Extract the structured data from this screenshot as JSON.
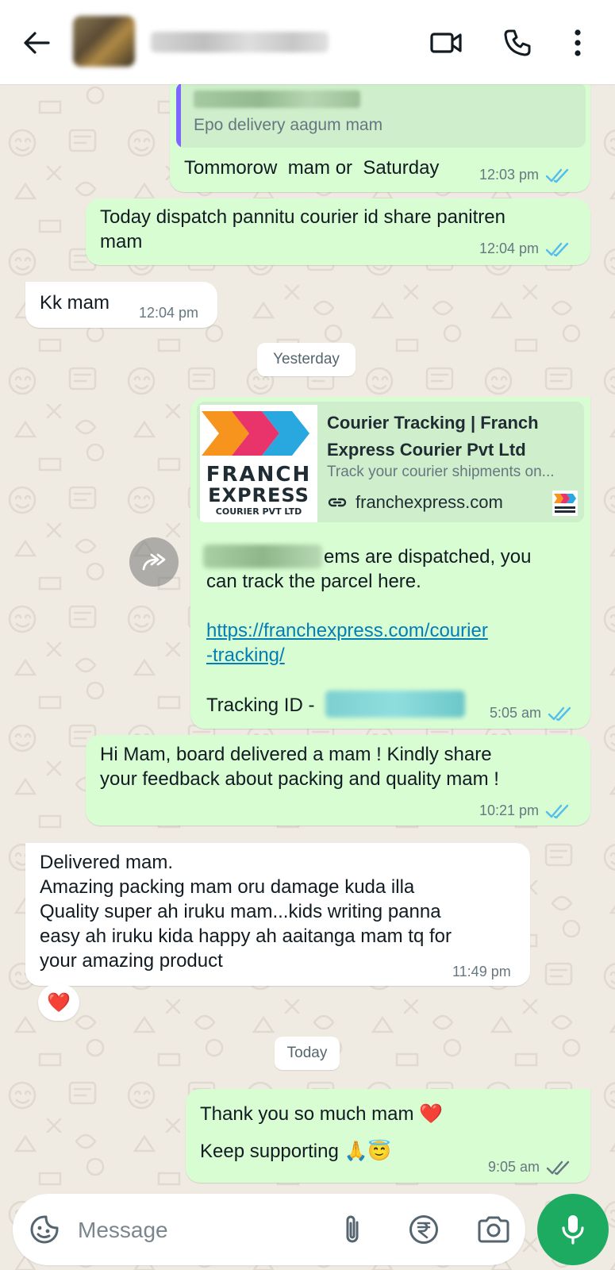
{
  "header": {
    "back_icon": "arrow-left-icon",
    "video_icon": "video-camera-icon",
    "call_icon": "phone-icon",
    "menu_icon": "more-vertical-icon"
  },
  "messages": {
    "m1": {
      "quote_text": "Epo delivery aagum mam",
      "text": "Tommorow  mam or  Saturday",
      "time": "12:03 pm",
      "status": "read"
    },
    "m2": {
      "text": "Today dispatch pannitu courier id share panitren\nmam",
      "time": "12:04 pm",
      "status": "read"
    },
    "m3": {
      "text": "Kk mam",
      "time": "12:04 pm"
    },
    "date1": "Yesterday",
    "m4": {
      "preview_title": "Courier Tracking | Franch Express Courier Pvt Ltd",
      "preview_desc": "Track your courier shipments on...",
      "preview_domain": "franchexpress.com",
      "logo_line1": "FRANCH",
      "logo_line2": "EXPRESS",
      "logo_line3": "COURIER PVT LTD",
      "text_line1_end": "ems are dispatched, you",
      "text_line2": "can track the parcel here.",
      "link": "https://franchexpress.com/courier\n-tracking/",
      "tracking_label": "Tracking ID - ",
      "time": "5:05 am",
      "status": "read"
    },
    "m5": {
      "text": "Hi Mam, board delivered a mam ! Kindly share\nyour feedback about packing and quality mam !",
      "time": "10:21 pm",
      "status": "read"
    },
    "m6": {
      "text": "Delivered mam.\nAmazing packing mam oru damage kuda illa\nQuality super ah iruku mam...kids writing panna\neasy ah iruku kida happy ah aaitanga mam tq for\nyour amazing product",
      "time": "11:49 pm",
      "reaction": "❤️"
    },
    "date2": "Today",
    "m7": {
      "line1": "Thank you so much mam ❤️",
      "line2": "Keep supporting 🙏😇",
      "time": "9:05 am",
      "status": "delivered"
    }
  },
  "input": {
    "placeholder": "Message",
    "value": ""
  },
  "colors": {
    "outgoing": "#d9fdd3",
    "incoming": "#ffffff",
    "read_tick": "#53bdeb",
    "mic_button": "#1daa61"
  }
}
